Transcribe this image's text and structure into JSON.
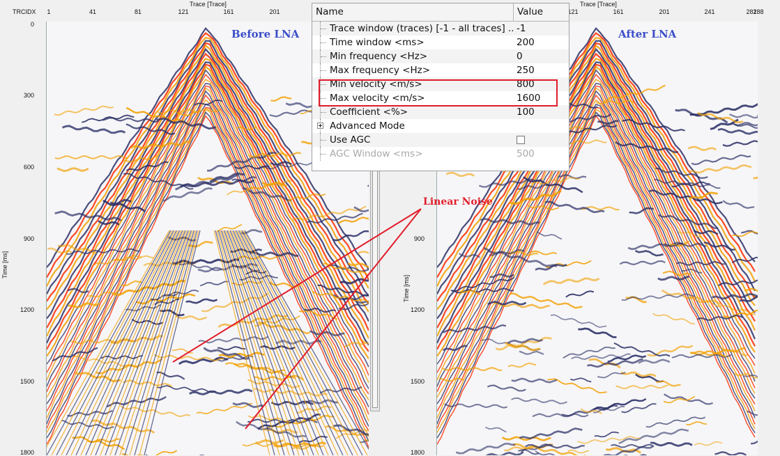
{
  "colors": {
    "positive_wiggle": "#f2a000",
    "negative_wiggle": "#2b2f66",
    "peak": "#ff2a00",
    "background": "#f6f6f8",
    "annotation": "#e11d2a",
    "panel_label": "#3b4ec8"
  },
  "left_panel": {
    "label": "Before LNA",
    "axis_header_left": "TRCIDX",
    "x_axis_title": "Trace [Trace]",
    "x_ticks": [
      "1",
      "41",
      "81",
      "121",
      "161",
      "201"
    ],
    "y_axis_title": "Time [ms]",
    "y_ticks": [
      "0",
      "300",
      "600",
      "900",
      "1200",
      "1500",
      "1800"
    ]
  },
  "right_panel": {
    "label": "After LNA",
    "x_axis_title": "Trace [Trace]",
    "x_ticks": [
      "121",
      "161",
      "201",
      "241",
      "281",
      "288"
    ],
    "y_axis_title": "Time [ms]",
    "y_ticks": [
      "900",
      "1200",
      "1500",
      "1800"
    ]
  },
  "property_grid": {
    "header_name": "Name",
    "header_value": "Value",
    "rows": [
      {
        "name": "Trace window (traces) [-1 - all traces] ...",
        "value": "-1"
      },
      {
        "name": "Time window <ms>",
        "value": "200"
      },
      {
        "name": "Min frequency <Hz>",
        "value": "0"
      },
      {
        "name": "Max frequency <Hz>",
        "value": "250"
      },
      {
        "name": "Min velocity <m/s>",
        "value": "800"
      },
      {
        "name": "Max velocity <m/s>",
        "value": "1600"
      },
      {
        "name": "Coefficient <%>",
        "value": "100"
      },
      {
        "name": "Advanced Mode",
        "value": ""
      },
      {
        "name": "Use AGC",
        "value": ""
      },
      {
        "name": "AGC Window <ms>",
        "value": "500"
      }
    ],
    "use_agc_checked": false
  },
  "annotation": {
    "label": "Linear Noise"
  }
}
